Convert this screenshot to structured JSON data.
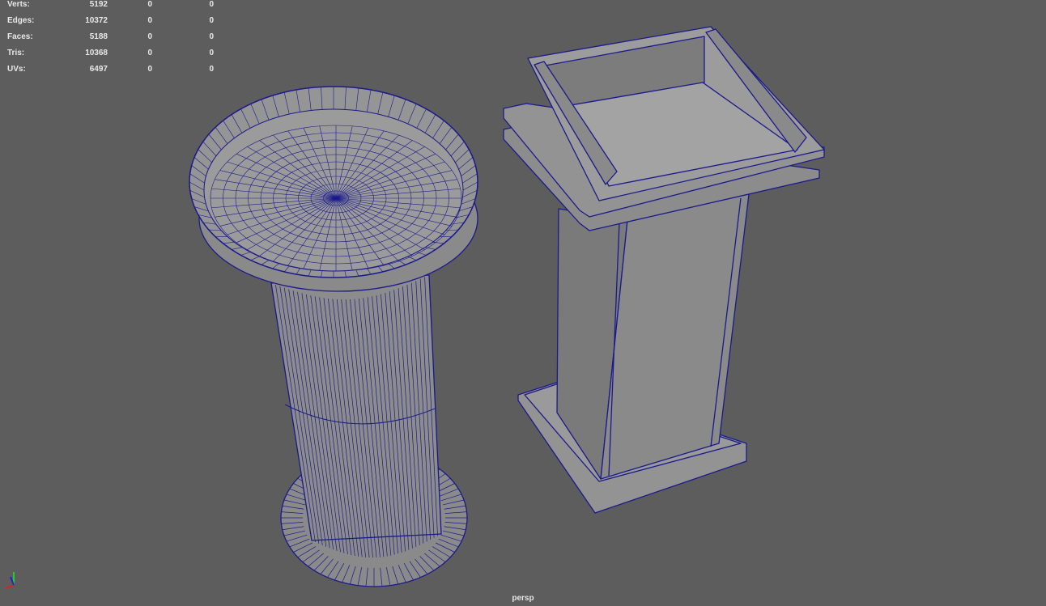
{
  "hud": {
    "rows": [
      {
        "label": "Verts:",
        "values": [
          "5192",
          "0",
          "0"
        ]
      },
      {
        "label": "Edges:",
        "values": [
          "10372",
          "0",
          "0"
        ]
      },
      {
        "label": "Faces:",
        "values": [
          "5188",
          "0",
          "0"
        ]
      },
      {
        "label": "Tris:",
        "values": [
          "10368",
          "0",
          "0"
        ]
      },
      {
        "label": "UVs:",
        "values": [
          "6497",
          "0",
          "0"
        ]
      }
    ]
  },
  "camera": {
    "name": "persp"
  },
  "colors": {
    "background": "#5d5d5d",
    "wireframe": "#1a1a8c",
    "surface": "#8e8e8e",
    "axis_x": "#e02020",
    "axis_y": "#20d020",
    "axis_z": "#2020e0"
  }
}
